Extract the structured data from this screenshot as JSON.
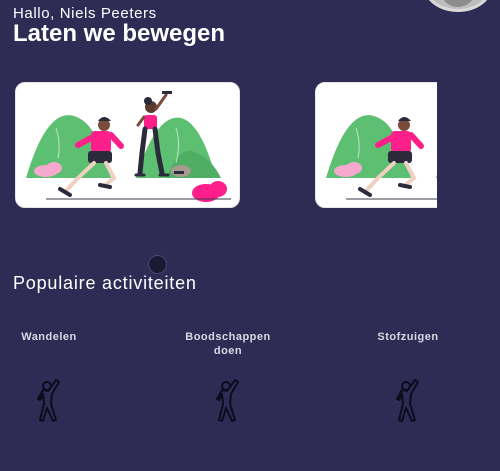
{
  "header": {
    "greeting": "Hallo, Niels Peeters",
    "title": "Laten we bewegen"
  },
  "carousel": {
    "cards": [
      {
        "illustration": "running-and-fitness-illustration"
      },
      {
        "illustration": "running-and-fitness-illustration"
      }
    ],
    "active_index": 0
  },
  "popular": {
    "title": "Populaire activiteiten",
    "items": [
      {
        "label": "Wandelen",
        "icon": "stretching-person-icon"
      },
      {
        "label": "Boodschappen\ndoen",
        "icon": "stretching-person-icon"
      },
      {
        "label": "Stofzuigen",
        "icon": "stretching-person-icon"
      }
    ]
  },
  "colors": {
    "background": "#2e2b54",
    "accent_pink": "#ff1f8a",
    "accent_green": "#5cbf72"
  }
}
